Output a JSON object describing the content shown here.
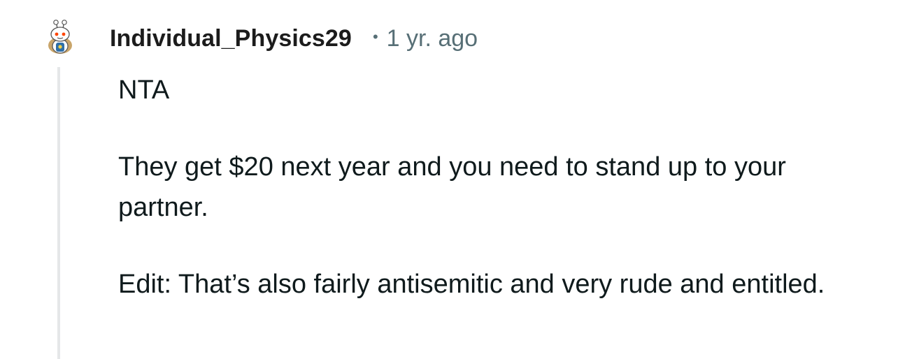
{
  "comment": {
    "author": "Individual_Physics29",
    "separator": "•",
    "timestamp": "1 yr. ago",
    "avatar_icon": "reddit-snoo-avatar-icon",
    "paragraphs": [
      "NTA",
      "They get $20 next year and you need to stand up to your partner.",
      "Edit: That’s also fairly antisemitic and very rude and entitled."
    ]
  },
  "colors": {
    "author": "#1c1c1c",
    "meta": "#576f76",
    "thread_line": "#e5e7e8",
    "body_text": "#0f1a1c"
  }
}
